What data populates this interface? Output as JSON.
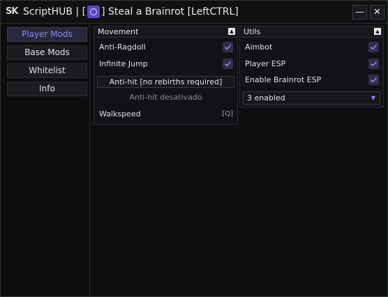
{
  "window": {
    "logo": "SK",
    "title_prefix": "ScriptHUB | [",
    "title_suffix": "] Steal a Brainrot [LeftCTRL]",
    "minimize_label": "—",
    "close_label": "✕"
  },
  "sidebar": {
    "items": [
      {
        "label": "Player Mods"
      },
      {
        "label": "Base Mods"
      },
      {
        "label": "Whitelist"
      },
      {
        "label": "Info"
      }
    ]
  },
  "movement": {
    "title": "Movement",
    "collapse_label": "▲",
    "anti_ragdoll": "Anti-Ragdoll",
    "infinite_jump": "Infinite Jump",
    "anti_hit_button": "Anti-hit [no rebirths required]",
    "anti_hit_status": "Anti-hit desativado",
    "walkspeed": "Walkspeed",
    "walkspeed_key": "[Q]"
  },
  "utils": {
    "title": "Utils",
    "collapse_label": "▲",
    "aimbot": "Aimbot",
    "player_esp": "Player ESP",
    "brainrot_esp": "Enable Brainrot ESP",
    "dropdown_value": "3 enabled",
    "dropdown_caret": "▼"
  },
  "colors": {
    "accent": "#8f86ff",
    "check_bg": "#302f48"
  }
}
